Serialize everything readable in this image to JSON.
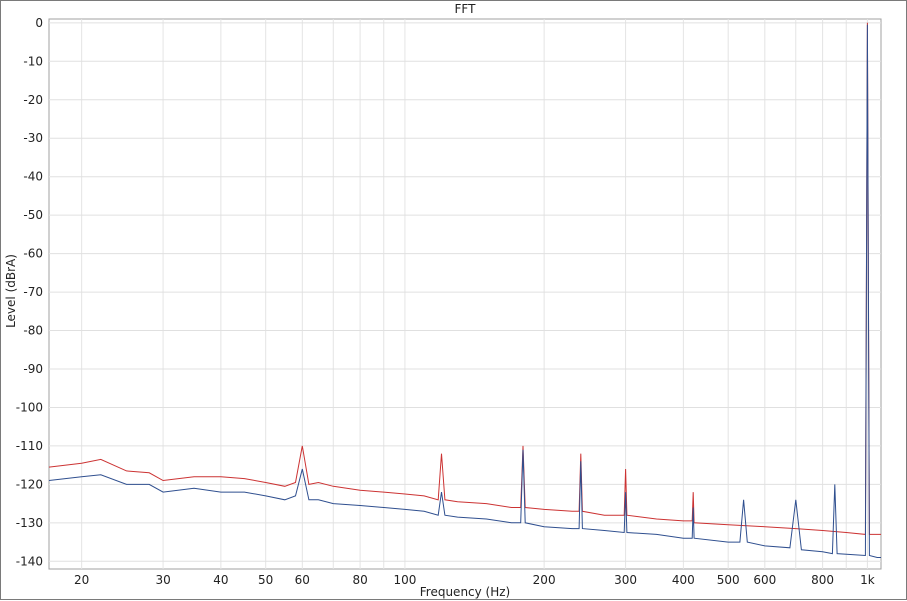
{
  "chart_data": {
    "type": "line",
    "title": "FFT",
    "xlabel": "Frequency (Hz)",
    "ylabel": "Level (dBrA)",
    "x_scale": "log",
    "xlim": [
      17,
      1070
    ],
    "ylim": [
      -142,
      1
    ],
    "x_ticks": [
      20,
      30,
      40,
      50,
      60,
      80,
      100,
      200,
      300,
      400,
      500,
      600,
      800,
      1000
    ],
    "x_tick_labels": [
      "20",
      "30",
      "40",
      "50",
      "60",
      "80",
      "100",
      "200",
      "300",
      "400",
      "500",
      "600",
      "800",
      "1k"
    ],
    "y_ticks": [
      0,
      -10,
      -20,
      -30,
      -40,
      -50,
      -60,
      -70,
      -80,
      -90,
      -100,
      -110,
      -120,
      -130,
      -140
    ],
    "y_tick_labels": [
      "0",
      "-10",
      "-20",
      "-30",
      "-40",
      "-50",
      "-60",
      "-70",
      "-80",
      "-90",
      "-100",
      "-110",
      "-120",
      "-130",
      "-140"
    ],
    "grid": true,
    "legend": "none",
    "series": [
      {
        "color": "#cc3333",
        "x": [
          17,
          20,
          22,
          25,
          28,
          30,
          35,
          40,
          45,
          50,
          55,
          58,
          60,
          62,
          65,
          70,
          80,
          90,
          100,
          110,
          118,
          120,
          122,
          130,
          150,
          170,
          178,
          180,
          182,
          200,
          230,
          238,
          240,
          242,
          270,
          298,
          300,
          302,
          350,
          400,
          418,
          420,
          422,
          500,
          600,
          700,
          800,
          900,
          990,
          1000,
          1010,
          1050,
          1070
        ],
        "y": [
          -115.5,
          -114.5,
          -113.5,
          -116.5,
          -117,
          -119,
          -118,
          -118,
          -118.5,
          -119.5,
          -120.5,
          -119.5,
          -110,
          -120,
          -119.5,
          -120.5,
          -121.5,
          -122,
          -122.5,
          -123,
          -124,
          -112,
          -124,
          -124.5,
          -125,
          -126,
          -126,
          -110,
          -126,
          -126.5,
          -127,
          -127,
          -112,
          -127,
          -128,
          -128,
          -116,
          -128,
          -129,
          -129.5,
          -129.5,
          -122,
          -130,
          -130.5,
          -131,
          -131.5,
          -132,
          -132.5,
          -133,
          0,
          -133,
          -133,
          -133
        ]
      },
      {
        "color": "#2f4f8f",
        "x": [
          17,
          20,
          22,
          25,
          28,
          30,
          35,
          40,
          45,
          50,
          55,
          58,
          60,
          62,
          65,
          70,
          80,
          90,
          100,
          110,
          118,
          120,
          122,
          130,
          150,
          170,
          178,
          180,
          182,
          200,
          230,
          238,
          240,
          242,
          270,
          298,
          300,
          302,
          350,
          400,
          418,
          420,
          422,
          500,
          530,
          540,
          550,
          600,
          680,
          700,
          720,
          800,
          840,
          850,
          860,
          990,
          1000,
          1010,
          1050,
          1070
        ],
        "y": [
          -119,
          -118,
          -117.5,
          -120,
          -120,
          -122,
          -121,
          -122,
          -122,
          -123,
          -124,
          -123,
          -116,
          -124,
          -124,
          -125,
          -125.5,
          -126,
          -126.5,
          -127,
          -128,
          -122,
          -128,
          -128.5,
          -129,
          -130,
          -130,
          -111,
          -130,
          -131,
          -131.5,
          -131.5,
          -114,
          -131.5,
          -132,
          -132.5,
          -122,
          -132.5,
          -133,
          -134,
          -134,
          -126,
          -134,
          -135,
          -135,
          -124,
          -135,
          -136,
          -136.5,
          -124,
          -137,
          -137.5,
          -138,
          -120,
          -138,
          -138.5,
          -0.5,
          -138.5,
          -139,
          -139
        ]
      }
    ]
  }
}
